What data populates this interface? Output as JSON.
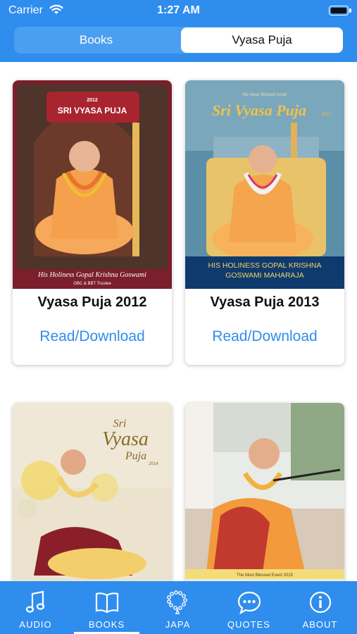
{
  "status_bar": {
    "carrier": "Carrier",
    "time": "1:27 AM"
  },
  "segments": {
    "books": "Books",
    "vyasa_puja": "Vyasa Puja",
    "selected": "Vyasa Puja"
  },
  "cards": [
    {
      "title": "Vyasa Puja 2012",
      "link": "Read/Download",
      "cover": {
        "year": "2012",
        "heading": "SRI VYASA PUJA",
        "caption": "His Holiness Gopal Krishna Goswami",
        "subcaption": "GBC & BBT Trustee"
      }
    },
    {
      "title": "Vyasa Puja 2013",
      "link": "Read/Download",
      "cover": {
        "tagline": "the most blessed event",
        "heading": "Sri Vyasa Puja",
        "year": "2013",
        "caption_line1": "HIS HOLINESS GOPAL KRISHNA",
        "caption_line2": "GOSWAMI MAHARAJA"
      }
    },
    {
      "cover": {
        "sri": "Sri",
        "vyasa": "Vyasa",
        "puja": "Puja",
        "year": "2014"
      }
    },
    {
      "cover": {
        "caption": "The Most Blessed Event 2015"
      }
    }
  ],
  "tabs": [
    {
      "label": "AUDIO",
      "icon": "music-note-icon"
    },
    {
      "label": "BOOKS",
      "icon": "book-icon",
      "active": true
    },
    {
      "label": "JAPA",
      "icon": "japa-beads-icon"
    },
    {
      "label": "QUOTES",
      "icon": "chat-bubble-icon"
    },
    {
      "label": "ABOUT",
      "icon": "info-icon"
    }
  ],
  "colors": {
    "accent": "#2f8ded",
    "link": "#2f8ded",
    "background": "#ffffff"
  }
}
